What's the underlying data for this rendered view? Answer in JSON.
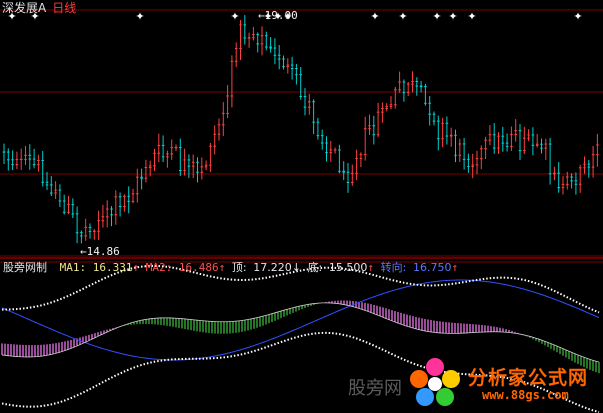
{
  "header": {
    "stock_name": "深发展A",
    "period": "日线"
  },
  "price_markers": {
    "high_label": "19.00",
    "low_label": "14.86"
  },
  "indicator": {
    "name": "股旁网制",
    "ma1_label": "MA1:",
    "ma1_value": "16.331",
    "ma1_arrow": "↑",
    "ma2_label": "MA2:",
    "ma2_value": "16.486",
    "ma2_arrow": "↑",
    "top_label": "顶:",
    "top_value": "17.220",
    "top_arrow": "↓",
    "bottom_label": "底:",
    "bottom_value": "15.500",
    "bottom_arrow": "↑",
    "turn_label": "转向:",
    "turn_value": "16.750",
    "turn_arrow": "↑"
  },
  "watermark": {
    "text1": "股旁网",
    "brand": "分析家公式网",
    "url": "www.88gs.com"
  },
  "colors": {
    "up_candle": "#ff4040",
    "down_candle": "#00d0d0",
    "grid": "#7a0000",
    "envelope": "#ffffff",
    "band_up": "#ff80ff",
    "band_down": "#40c040",
    "ma_line": "#3050ff",
    "brand": "#ff6600"
  },
  "chart_data": [
    {
      "type": "candlestick",
      "title": "深发展A 日线",
      "marked_high": 19.0,
      "marked_low": 14.86,
      "ylim": [
        14.5,
        19.3
      ],
      "grid": true
    },
    {
      "type": "line",
      "title": "股旁网制",
      "series": [
        {
          "name": "MA1",
          "last": 16.331
        },
        {
          "name": "MA2",
          "last": 16.486
        },
        {
          "name": "顶",
          "last": 17.22
        },
        {
          "name": "底",
          "last": 15.5
        },
        {
          "name": "转向",
          "last": 16.75
        }
      ]
    }
  ]
}
